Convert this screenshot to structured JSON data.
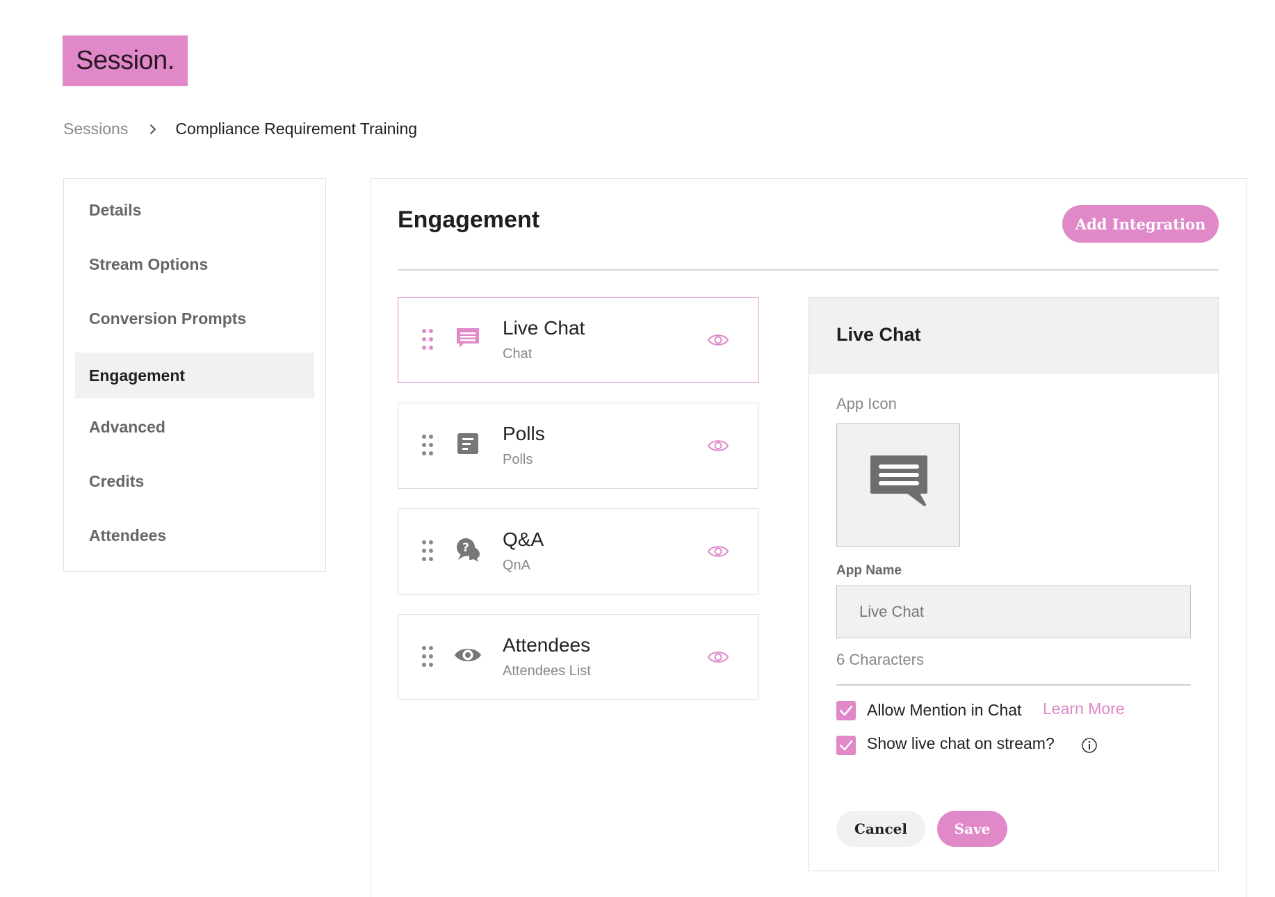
{
  "brand": {
    "logo_text": "Session.",
    "accent_color": "#e088c8"
  },
  "breadcrumb": {
    "parent": "Sessions",
    "current": "Compliance Requirement Training"
  },
  "sidebar": {
    "items": [
      {
        "label": "Details"
      },
      {
        "label": "Stream Options"
      },
      {
        "label": "Conversion Prompts"
      },
      {
        "label": "Engagement",
        "active": true
      },
      {
        "label": "Advanced"
      },
      {
        "label": "Credits"
      },
      {
        "label": "Attendees"
      }
    ]
  },
  "main": {
    "title": "Engagement",
    "add_button": "Add Integration",
    "integrations": [
      {
        "name": "Live Chat",
        "subtitle": "Chat",
        "icon": "chat-icon",
        "selected": true
      },
      {
        "name": "Polls",
        "subtitle": "Polls",
        "icon": "poll-icon"
      },
      {
        "name": "Q&A",
        "subtitle": "QnA",
        "icon": "qna-icon"
      },
      {
        "name": "Attendees",
        "subtitle": "Attendees List",
        "icon": "eye-icon"
      }
    ]
  },
  "detail": {
    "title": "Live Chat",
    "app_icon_label": "App Icon",
    "app_name_label": "App Name",
    "app_name_value": "Live Chat",
    "char_count": "6 Characters",
    "options": [
      {
        "label": "Allow Mention in Chat",
        "checked": true
      },
      {
        "label": "Show live chat on stream?",
        "checked": true
      }
    ],
    "learn_more": "Learn More",
    "cancel": "Cancel",
    "save": "Save"
  }
}
